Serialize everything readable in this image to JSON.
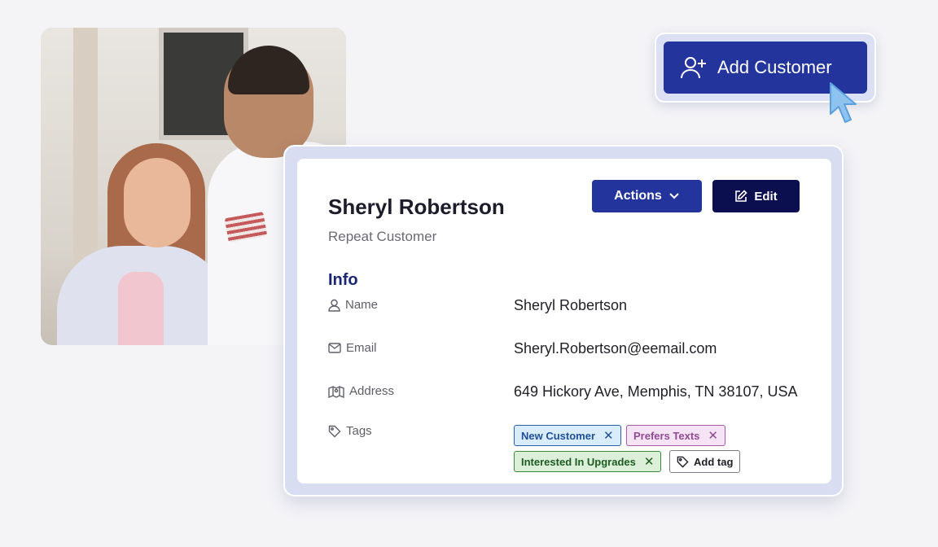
{
  "add_button": {
    "label": "Add Customer"
  },
  "customer": {
    "name": "Sheryl Robertson",
    "subtitle": "Repeat Customer"
  },
  "toolbar": {
    "actions_label": "Actions",
    "edit_label": "Edit"
  },
  "info": {
    "title": "Info",
    "fields": [
      {
        "label": "Name",
        "value": "Sheryl Robertson",
        "icon": "user-icon"
      },
      {
        "label": "Email",
        "value": "Sheryl.Robertson@eemail.com",
        "icon": "mail-icon"
      },
      {
        "label": "Address",
        "value": "649 Hickory Ave, Memphis, TN 38107, USA",
        "icon": "map-icon"
      },
      {
        "label": "Tags",
        "icon": "tag-icon"
      }
    ]
  },
  "tags": [
    {
      "label": "New Customer",
      "color": "#1f4f9a"
    },
    {
      "label": "Prefers Texts",
      "color": "#8f4b92"
    },
    {
      "label": "Interested In Upgrades",
      "color": "#1f5c24"
    }
  ],
  "add_tag_label": "Add tag",
  "colors": {
    "primary": "#23359c",
    "dark": "#0b0f4f",
    "accent_title": "#1a2673"
  }
}
